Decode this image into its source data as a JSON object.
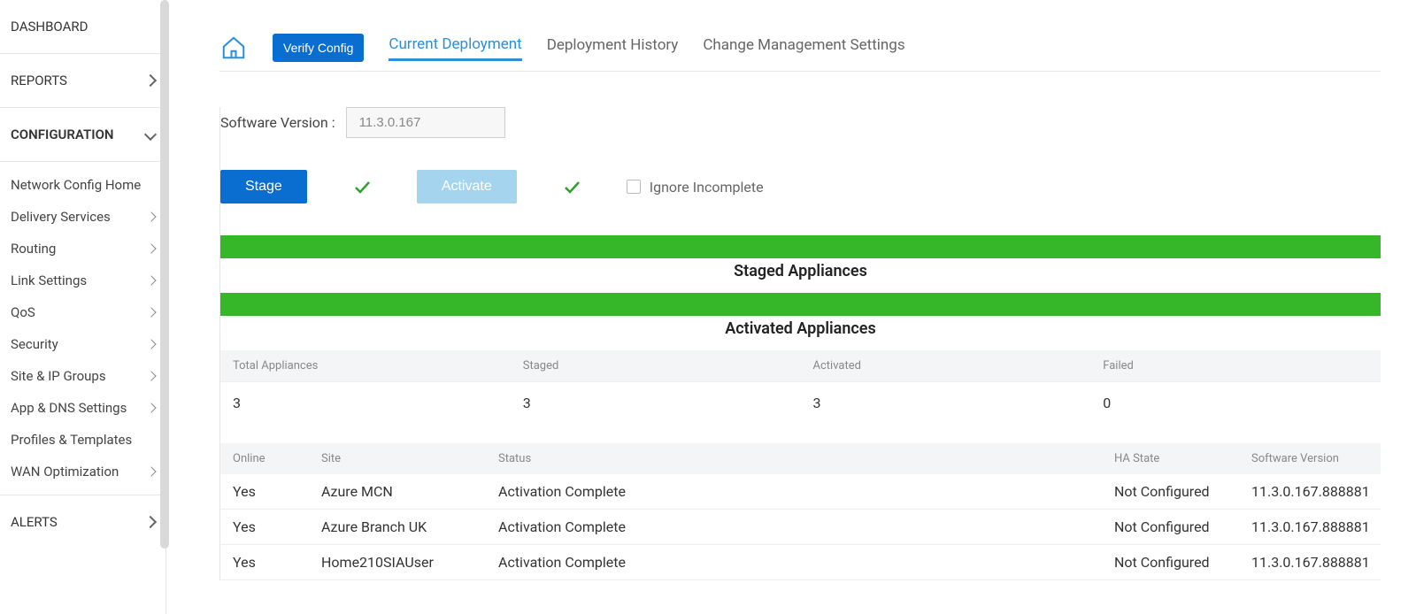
{
  "sidebar": {
    "sections": [
      {
        "label": "DASHBOARD",
        "expandable": false
      },
      {
        "label": "REPORTS",
        "expandable": true,
        "expanded": false
      },
      {
        "label": "CONFIGURATION",
        "expandable": true,
        "expanded": true
      }
    ],
    "config_items": [
      {
        "label": "Network Config Home",
        "expandable": false
      },
      {
        "label": "Delivery Services",
        "expandable": true
      },
      {
        "label": "Routing",
        "expandable": true
      },
      {
        "label": "Link Settings",
        "expandable": true
      },
      {
        "label": "QoS",
        "expandable": true
      },
      {
        "label": "Security",
        "expandable": true
      },
      {
        "label": "Site & IP Groups",
        "expandable": true
      },
      {
        "label": "App & DNS Settings",
        "expandable": true
      },
      {
        "label": "Profiles & Templates",
        "expandable": false
      },
      {
        "label": "WAN Optimization",
        "expandable": true
      }
    ],
    "alerts_label": "ALERTS"
  },
  "top": {
    "verify_label": "Verify Config",
    "tabs": [
      {
        "label": "Current Deployment",
        "active": true
      },
      {
        "label": "Deployment History",
        "active": false
      },
      {
        "label": "Change Management Settings",
        "active": false
      }
    ]
  },
  "sw_version": {
    "label": "Software Version :",
    "value": "11.3.0.167"
  },
  "actions": {
    "stage_label": "Stage",
    "activate_label": "Activate",
    "ignore_label": "Ignore Incomplete"
  },
  "sections": {
    "staged_label": "Staged Appliances",
    "activated_label": "Activated Appliances"
  },
  "summary": {
    "headers": {
      "total": "Total Appliances",
      "staged": "Staged",
      "activated": "Activated",
      "failed": "Failed"
    },
    "values": {
      "total": "3",
      "staged": "3",
      "activated": "3",
      "failed": "0"
    }
  },
  "details": {
    "headers": {
      "online": "Online",
      "site": "Site",
      "status": "Status",
      "ha": "HA State",
      "sv": "Software Version"
    },
    "rows": [
      {
        "online": "Yes",
        "site": "Azure MCN",
        "status": "Activation Complete",
        "ha": "Not Configured",
        "sv": "11.3.0.167.888881"
      },
      {
        "online": "Yes",
        "site": "Azure Branch UK",
        "status": "Activation Complete",
        "ha": "Not Configured",
        "sv": "11.3.0.167.888881"
      },
      {
        "online": "Yes",
        "site": "Home210SIAUser",
        "status": "Activation Complete",
        "ha": "Not Configured",
        "sv": "11.3.0.167.888881"
      }
    ]
  }
}
